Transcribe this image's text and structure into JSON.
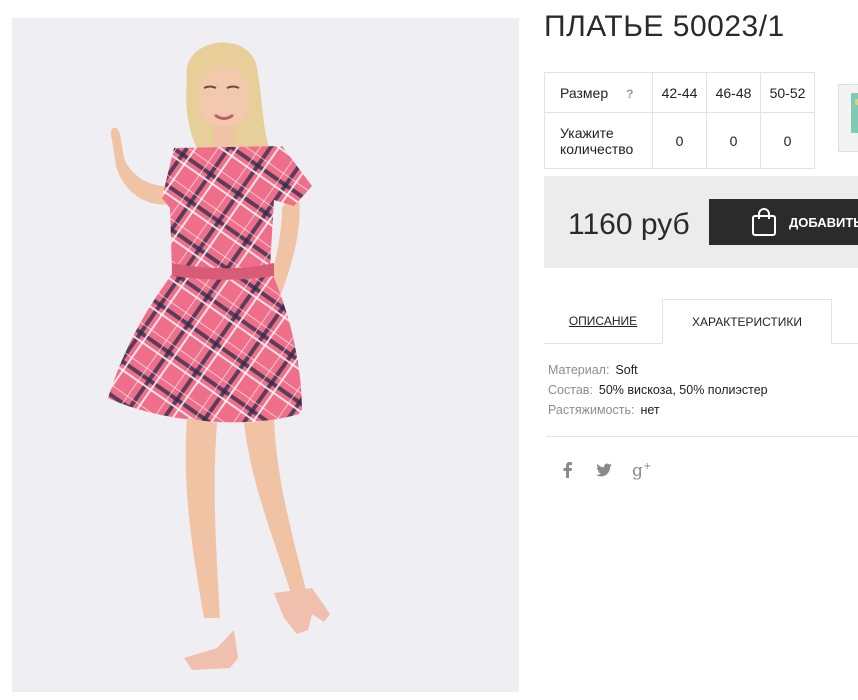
{
  "product": {
    "title": "ПЛАТЬЕ 50023/1",
    "price": "1160 руб",
    "add_button_label": "ДОБАВИТЬ"
  },
  "size_table": {
    "label_size": "Размер",
    "help": "?",
    "label_qty": "Укажите количество",
    "sizes": [
      "42-44",
      "46-48",
      "50-52"
    ],
    "quantities": [
      "0",
      "0",
      "0"
    ]
  },
  "tabs": {
    "description": "ОПИСАНИЕ",
    "characteristics": "ХАРАКТЕРИСТИКИ"
  },
  "characteristics": [
    {
      "key": "Материал:",
      "value": "Soft"
    },
    {
      "key": "Состав:",
      "value": "50% вискоза, 50% полиэстер"
    },
    {
      "key": "Растяжимость:",
      "value": "нет"
    }
  ],
  "social_icons": [
    "facebook-icon",
    "twitter-icon",
    "google-plus-icon"
  ],
  "colors": {
    "button_bg": "#2b2b2b",
    "price_bar_bg": "#ececec",
    "photo_bg": "#efeef2",
    "dress": "#ef6f8a"
  }
}
